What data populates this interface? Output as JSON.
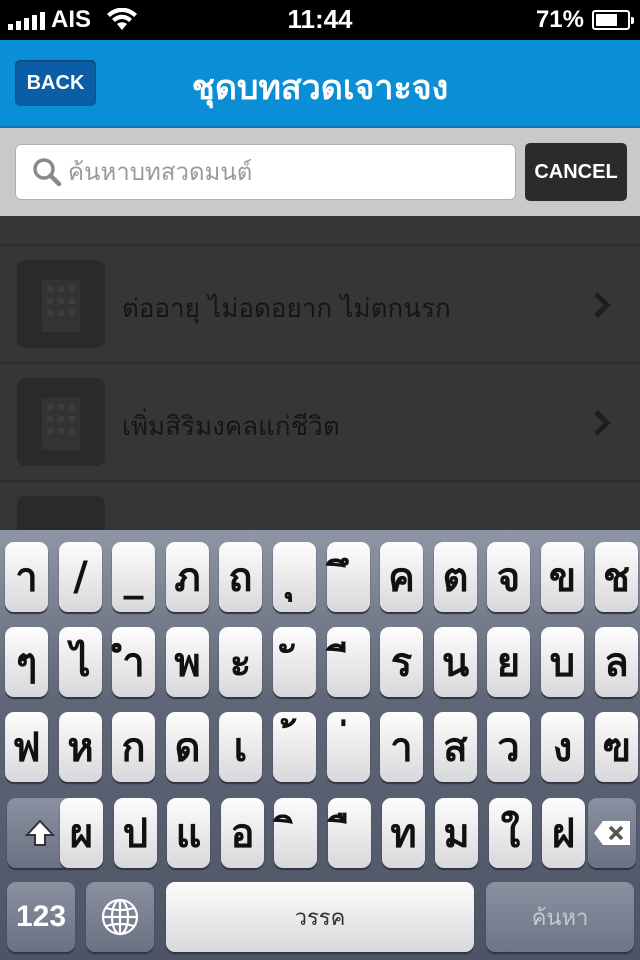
{
  "status_bar": {
    "carrier": "AIS",
    "time": "11:44",
    "battery": "71%",
    "battery_level": 0.71
  },
  "nav": {
    "back_label": "BACK",
    "title": "ชุดบทสวดเจาะจง"
  },
  "search": {
    "placeholder": "ค้นหาบทสวดมนต์",
    "value": "",
    "cancel_label": "CANCEL"
  },
  "list": {
    "items": [
      {
        "label": ""
      },
      {
        "label": "ต่ออายุ ไม่อดอยาก ไม่ตกนรก"
      },
      {
        "label": "เพิ่มสิริมงคลแก่ชีวิต"
      },
      {
        "label": ""
      }
    ]
  },
  "keyboard": {
    "row1": [
      "า",
      "/",
      "_",
      "ภ",
      "ถ",
      "ุ",
      "ึ",
      "ค",
      "ต",
      "จ",
      "ข",
      "ช"
    ],
    "row2": [
      "ๆ",
      "ไ",
      "ำ",
      "พ",
      "ะ",
      "ั",
      "ี",
      "ร",
      "น",
      "ย",
      "บ",
      "ล"
    ],
    "row3": [
      "ฟ",
      "ห",
      "ก",
      "ด",
      "เ",
      "้",
      "่",
      "า",
      "ส",
      "ว",
      "ง",
      "ฃ"
    ],
    "row4": [
      "ผ",
      "ป",
      "แ",
      "อ",
      "ิ",
      "ื",
      "ท",
      "ม",
      "ใ",
      "ฝ"
    ],
    "numbers_label": "123",
    "space_label": "วรรค",
    "search_label": "ค้นหา"
  }
}
